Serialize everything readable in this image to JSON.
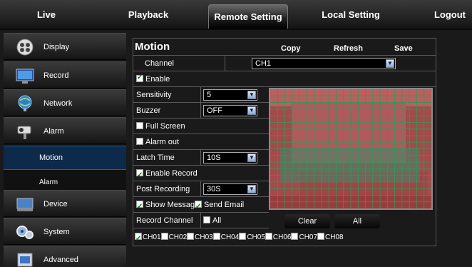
{
  "nav": {
    "tabs": [
      {
        "label": "Live"
      },
      {
        "label": "Playback"
      },
      {
        "label": "Remote Setting"
      },
      {
        "label": "Local Setting"
      },
      {
        "label": "Logout"
      }
    ],
    "active_tab": "Remote Setting"
  },
  "sidebar": {
    "items": [
      {
        "label": "Display",
        "icon": "display-icon"
      },
      {
        "label": "Record",
        "icon": "record-icon"
      },
      {
        "label": "Network",
        "icon": "network-icon"
      },
      {
        "label": "Alarm",
        "icon": "alarm-icon"
      },
      {
        "label": "Device",
        "icon": "device-icon"
      },
      {
        "label": "System",
        "icon": "system-icon"
      },
      {
        "label": "Advanced",
        "icon": "advanced-icon"
      }
    ],
    "sub_items": [
      {
        "label": "Motion",
        "active": true
      },
      {
        "label": "Alarm",
        "active": false
      }
    ]
  },
  "motion": {
    "title": "Motion",
    "copy_label": "Copy",
    "refresh_label": "Refresh",
    "save_label": "Save",
    "channel_label": "Channel",
    "channel_value": "CH1",
    "enable_label": "Enable",
    "enable_checked": true,
    "sensitivity_label": "Sensitivity",
    "sensitivity_value": "5",
    "buzzer_label": "Buzzer",
    "buzzer_value": "OFF",
    "full_screen_label": "Full Screen",
    "full_screen_checked": false,
    "alarm_out_label": "Alarm out",
    "alarm_out_checked": false,
    "latch_time_label": "Latch Time",
    "latch_time_value": "10S",
    "enable_record_label": "Enable Record",
    "enable_record_checked": true,
    "post_recording_label": "Post Recording",
    "post_recording_value": "30S",
    "show_message_label": "Show Message",
    "show_message_checked": true,
    "send_email_label": "Send Email",
    "send_email_checked": true,
    "record_channel_label": "Record Channel",
    "all_label": "All",
    "all_checked": false,
    "channels": [
      {
        "label": "CH01",
        "checked": true
      },
      {
        "label": "CH02",
        "checked": false
      },
      {
        "label": "CH03",
        "checked": false
      },
      {
        "label": "CH04",
        "checked": false
      },
      {
        "label": "CH05",
        "checked": false
      },
      {
        "label": "CH06",
        "checked": false
      },
      {
        "label": "CH07",
        "checked": false
      },
      {
        "label": "CH08",
        "checked": false
      }
    ],
    "clear_label": "Clear",
    "grid_all_label": "All"
  },
  "colors": {
    "accent": "#0d2a4a",
    "motion_zone": "#e03a3a",
    "grid_line": "#2e9a5a",
    "checkbox_check": "#007700"
  }
}
